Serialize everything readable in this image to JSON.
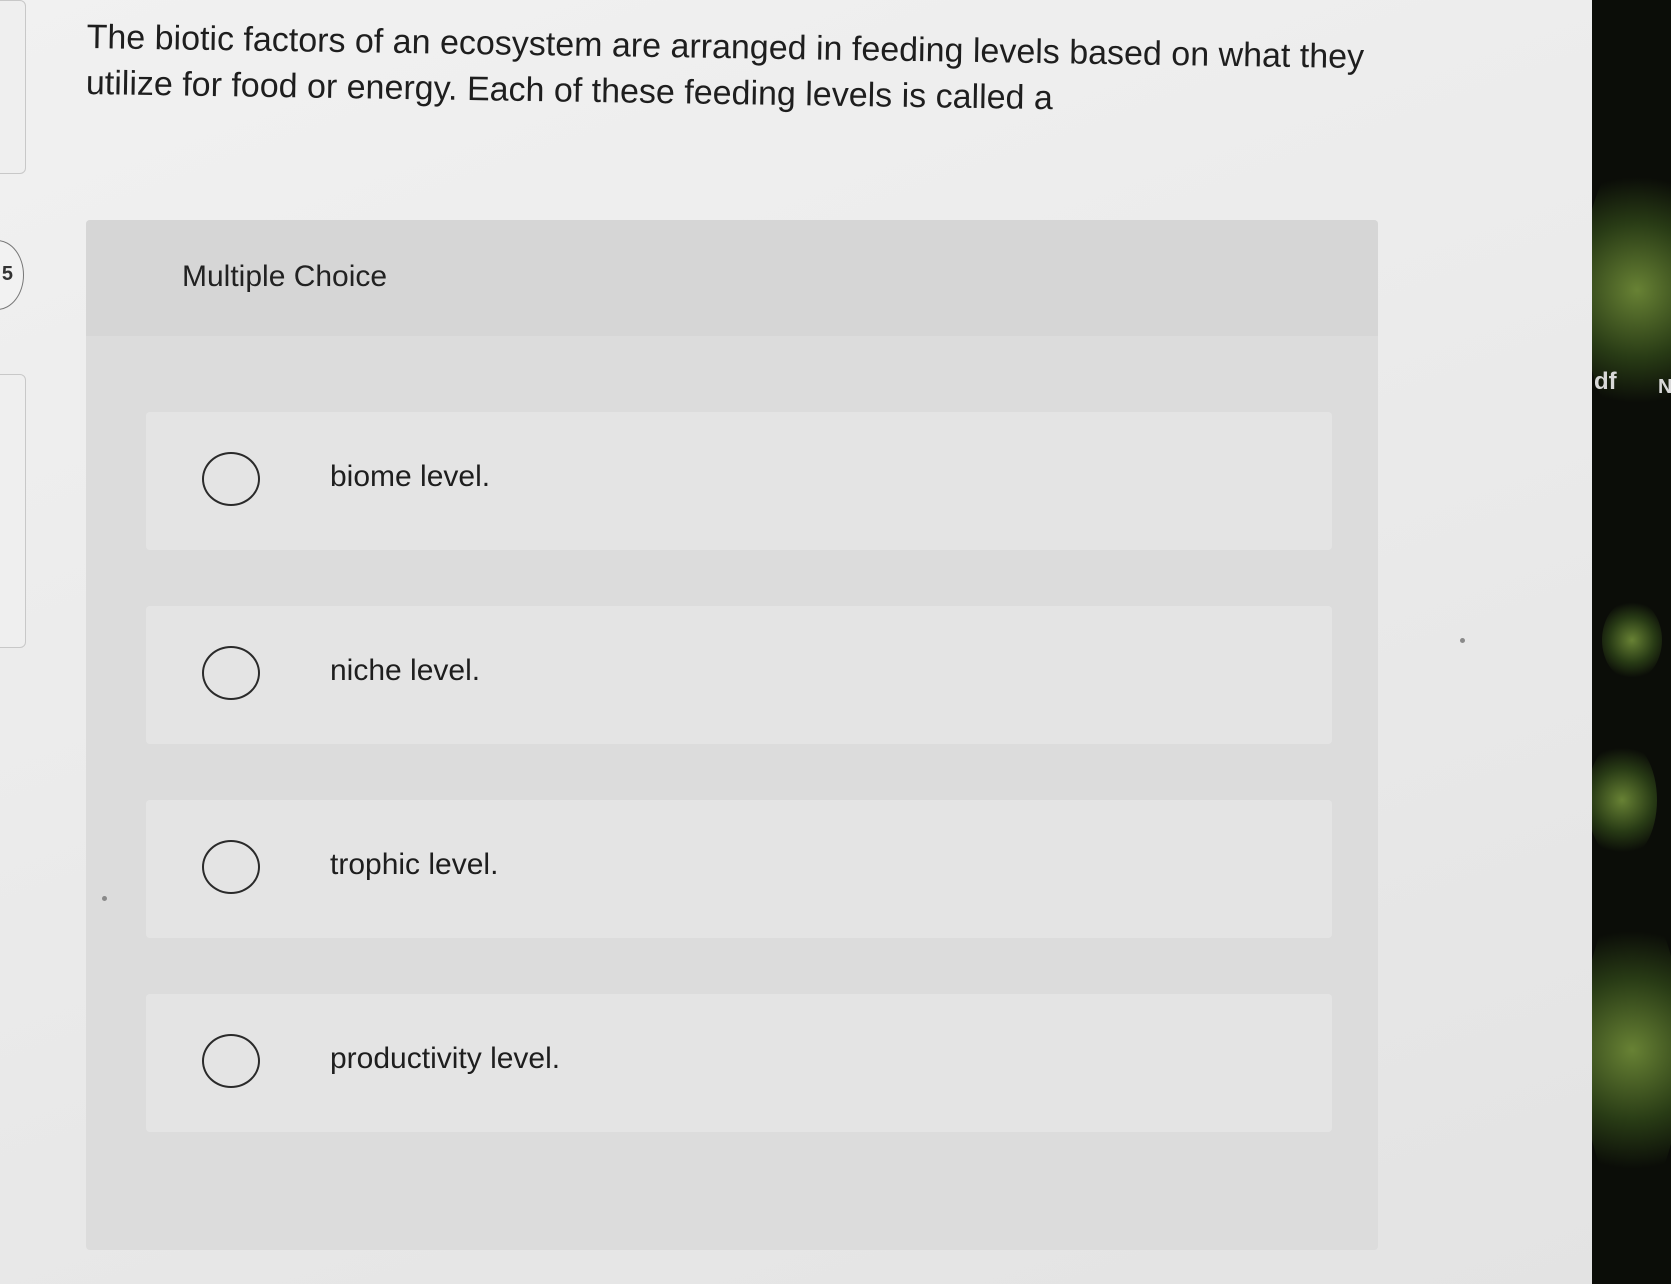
{
  "question": {
    "text": "The biotic factors of an ecosystem are arranged in feeding levels based on what they utilize for food or energy. Each of these feeding levels is called a"
  },
  "multiple_choice": {
    "label": "Multiple Choice",
    "options": [
      {
        "label": "biome level."
      },
      {
        "label": "niche level."
      },
      {
        "label": "trophic level."
      },
      {
        "label": "productivity level."
      }
    ]
  },
  "left_edge": {
    "partial_text": "5"
  },
  "outside_screen": {
    "partial_text_1": "df",
    "partial_text_2": "N"
  },
  "colors": {
    "screen_background": "#eeeeee",
    "panel_background": "#dcdcdc",
    "option_background": "#e4e4e4",
    "text": "#1e1e1e",
    "outside_background": "#0b0d08"
  }
}
